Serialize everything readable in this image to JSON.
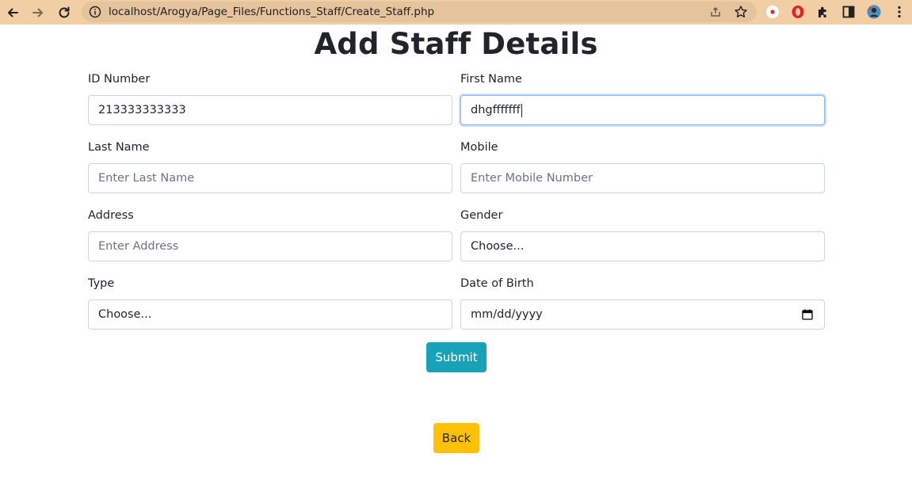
{
  "browser": {
    "url": "localhost/Arogya/Page_Files/Functions_Staff/Create_Staff.php",
    "toolbar_color": "#f2cea4"
  },
  "page": {
    "title": "Add Staff Details"
  },
  "form": {
    "id_number": {
      "label": "ID Number",
      "value": "213333333333",
      "placeholder": ""
    },
    "first_name": {
      "label": "First Name",
      "value": "dhgfffffff",
      "placeholder": ""
    },
    "last_name": {
      "label": "Last Name",
      "value": "",
      "placeholder": "Enter Last Name"
    },
    "mobile": {
      "label": "Mobile",
      "value": "",
      "placeholder": "Enter Mobile Number"
    },
    "address": {
      "label": "Address",
      "value": "",
      "placeholder": "Enter Address"
    },
    "gender": {
      "label": "Gender",
      "selected": "Choose..."
    },
    "type": {
      "label": "Type",
      "selected": "Choose..."
    },
    "dob": {
      "label": "Date of Birth",
      "placeholder": "mm/dd/yyyy"
    }
  },
  "buttons": {
    "submit_label": "Submit",
    "back_label": "Back",
    "submit_color": "#17a2b8",
    "back_color": "#ffc107"
  }
}
